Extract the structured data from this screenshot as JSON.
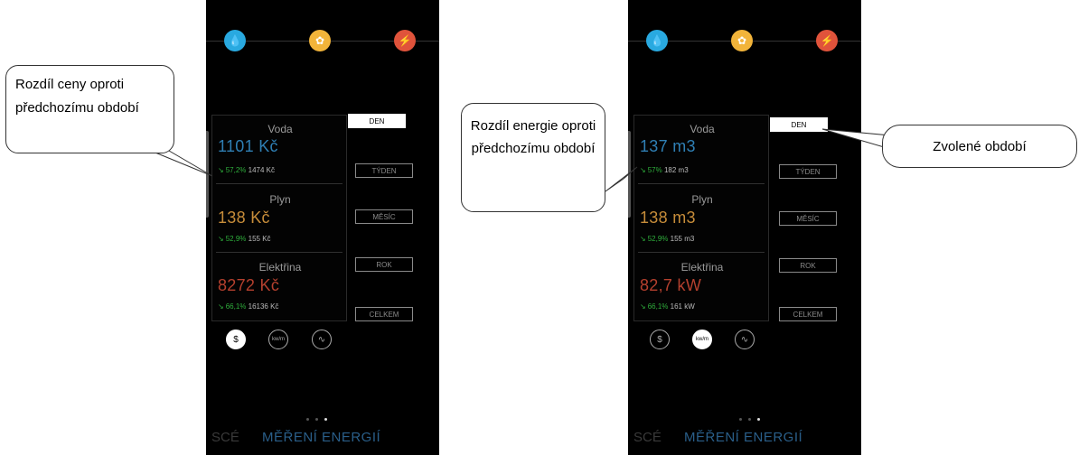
{
  "callouts": {
    "price_diff": "Rozdíl ceny oproti předchozímu období",
    "energy_diff": "Rozdíl energie oproti předchozímu období",
    "selected_period": "Zvolené období"
  },
  "colors": {
    "water": "#29a9e0",
    "gas": "#f2b43a",
    "electricity": "#e0533b",
    "trend_down": "#2fae3c"
  },
  "periods": [
    "DEN",
    "TÝDEN",
    "MĚSÍC",
    "ROK",
    "CELKEM"
  ],
  "selected_period": "DEN",
  "screens": [
    {
      "active_mode": "currency",
      "rows": [
        {
          "name": "Voda",
          "value": "1101 Kč",
          "pct": "57,2%",
          "prev": "1474 Kč"
        },
        {
          "name": "Plyn",
          "value": "138 Kč",
          "pct": "52,9%",
          "prev": "155 Kč"
        },
        {
          "name": "Elektřina",
          "value": "8272 Kč",
          "pct": "66,1%",
          "prev": "16136 Kč"
        }
      ]
    },
    {
      "active_mode": "energy",
      "rows": [
        {
          "name": "Voda",
          "value": "137 m3",
          "pct": "57%",
          "prev": "182 m3"
        },
        {
          "name": "Plyn",
          "value": "138 m3",
          "pct": "52,9%",
          "prev": "155 m3"
        },
        {
          "name": "Elektřina",
          "value": "82,7 kW",
          "pct": "66,1%",
          "prev": "161 kW"
        }
      ]
    }
  ],
  "modes": {
    "currency": "$",
    "energy": "kw/m",
    "chart": "chart"
  },
  "bottom": {
    "prev": "SCÉ",
    "title": "MĚŘENÍ ENERGIÍ"
  }
}
